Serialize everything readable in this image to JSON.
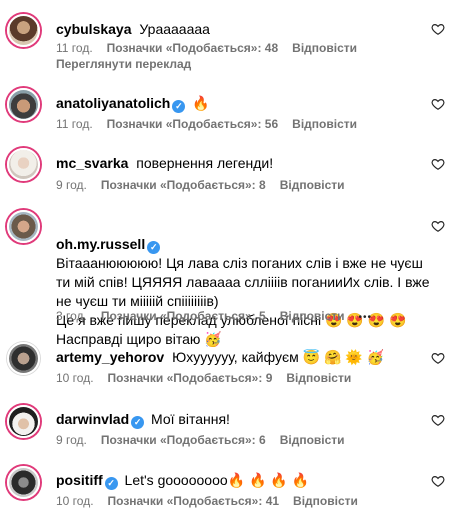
{
  "meta_likes_prefix": "Позначки «Подобається»: ",
  "reply_label": "Відповісти",
  "comments": [
    {
      "user": "cybulskaya",
      "verified": false,
      "text": "Урааааааа",
      "time": "11 год.",
      "likes": "48",
      "translate": "Переглянути переклад"
    },
    {
      "user": "anatoliyanatolich",
      "verified": true,
      "text": "🔥",
      "time": "11 год.",
      "likes": "56"
    },
    {
      "user": "mc_svarka",
      "verified": false,
      "text": "повернення легенди!",
      "time": "9 год.",
      "likes": "8"
    },
    {
      "user": "oh.my.russell",
      "verified": true,
      "text": "Вітааанююююю! Ця лава сліз поганих слів і вже не чуєш ти мій спів! ЦЯЯЯЯ лаваааа слліііів поганииИх слів. І вже не чуєш ти мііііій спіііііііів)\nЦе я вже пишу переклад улюбленої пісні 😍 😍 😍 😍\nНасправді щиро вітаю 🥳",
      "time": "3 год.",
      "likes": "5",
      "more": "•••"
    },
    {
      "user": "artemy_yehorov",
      "verified": false,
      "text": "Юхуууууу, кайфуєм 😇 🤗 🌞 🥳",
      "time": "10 год.",
      "likes": "9"
    },
    {
      "user": "darwinvlad",
      "verified": true,
      "text": "Мої вітання!",
      "time": "9 год.",
      "likes": "6"
    },
    {
      "user": "positiff",
      "verified": true,
      "text": "Let's goooooooo🔥 🔥 🔥 🔥",
      "time": "10 год.",
      "likes": "41"
    }
  ],
  "icons": {
    "like": "heart-outline-icon",
    "verified": "verified-badge-icon",
    "more": "more-options-icon"
  },
  "colors": {
    "ring": "#e03a7a",
    "verified": "#3897f0",
    "meta": "#737373"
  }
}
